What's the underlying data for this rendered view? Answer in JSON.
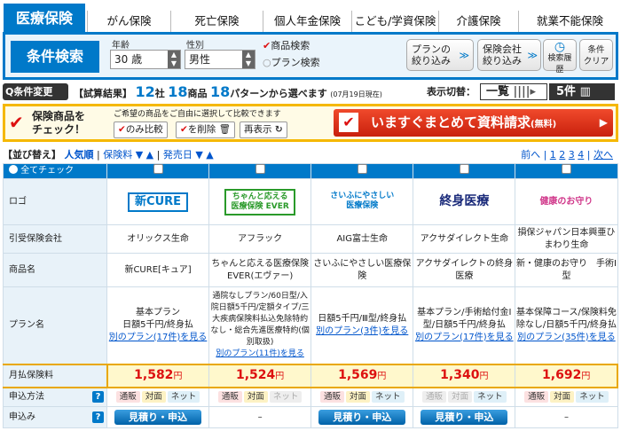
{
  "tabs": [
    "医療保険",
    "がん保険",
    "死亡保険",
    "個人年金保険",
    "こども/学資保険",
    "介護保険",
    "就業不能保険"
  ],
  "search": {
    "title": "条件検索",
    "age_label": "年齢",
    "age_value": "30 歳",
    "sex_label": "性別",
    "sex_value": "男性",
    "product_search": "商品検索",
    "plan_search": "プラン検索",
    "btn_plan": "プランの\n絞り込み",
    "btn_company": "保険会社\n絞り込み",
    "btn_history": "検索履歴",
    "btn_clear": "条件\nクリア"
  },
  "result": {
    "change_label": "Q条件変更",
    "prefix": "【試算結果】",
    "companies": "12",
    "company_unit": "社",
    "products": "18",
    "product_unit": "商品",
    "patterns": "18",
    "pattern_suffix": "パターンから選べます",
    "date": "(07月19日現在)",
    "display_switch": "表示切替：",
    "list_label": "一覧",
    "five_label": "5件"
  },
  "cta": {
    "line1": "保険商品を",
    "line2": "チェック！",
    "hint": "ご希望の商品をご自由に選択して比較できます",
    "compare": "のみ比較",
    "remove": "を削除",
    "research": "再表示",
    "request": "いますぐまとめて資料請求",
    "request_suffix": "(無料)"
  },
  "sort": {
    "prefix": "【並び替え】",
    "popular": "人気順",
    "premium": "保険料",
    "release": "発売日",
    "prev": "前へ",
    "pages": [
      "1",
      "2",
      "3",
      "4"
    ],
    "next": "次へ"
  },
  "table": {
    "check_all": "全てチェック",
    "rows": {
      "logo": "ロゴ",
      "company": "引受保険会社",
      "product": "商品名",
      "plan": "プラン名",
      "premium": "月払保険料",
      "method": "申込方法",
      "apply": "申込み"
    },
    "products": [
      {
        "logo": "新CURE",
        "company": "オリックス生命",
        "product": "新CURE[キュア]",
        "plan": "基本プラン\n日額5千円/終身払",
        "plan_link": "別のプラン(17件)を見る",
        "price": "1,582",
        "apply": "見積り・申込"
      },
      {
        "logo": "ちゃんと応える医療保険 EVER",
        "company": "アフラック",
        "product": "ちゃんと応える医療保険　EVER(エヴァー)",
        "plan": "通院なしプラン/60日型/入院日額5千円/定額タイプ/三大疾病保険料払込免除特約なし・総合先進医療特約(個別取扱)",
        "plan_link": "別のプラン(11件)を見る",
        "price": "1,524",
        "apply": "–"
      },
      {
        "logo": "さいふにやさしい医療保険",
        "company": "AIG富士生命",
        "product": "さいふにやさしい医療保険",
        "plan": "日額5千円/Ⅲ型/終身払",
        "plan_link": "別のプラン(3件)を見る",
        "price": "1,569",
        "apply": "見積り・申込"
      },
      {
        "logo": "終身医療",
        "company": "アクサダイレクト生命",
        "product": "アクサダイレクトの終身医療",
        "plan": "基本プラン/手術給付金Ⅰ型/日額5千円/終身払",
        "plan_link": "別のプラン(17件)を見る",
        "price": "1,340",
        "apply": "見積り・申込"
      },
      {
        "logo": "健康のお守り",
        "company": "損保ジャパン日本興亜ひまわり生命",
        "product": "新・健康のお守り　手術Ⅰ型",
        "plan": "基本保障コース/保険料免除なし/日額5千円/終身払",
        "plan_link": "別のプラン(35件)を見る",
        "price": "1,692",
        "apply": "–"
      }
    ],
    "yen": "円",
    "tags": [
      "通販",
      "対面",
      "ネット"
    ]
  }
}
